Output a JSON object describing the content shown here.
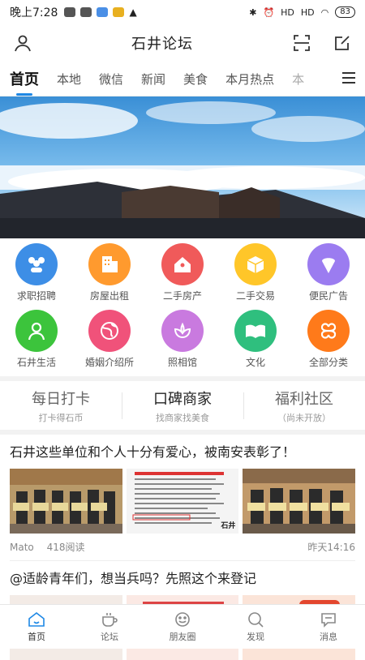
{
  "status": {
    "time": "晚上7:28",
    "battery": "83",
    "signal1": "HD",
    "signal2": "HD"
  },
  "header": {
    "title": "石井论坛"
  },
  "tabs": [
    "首页",
    "本地",
    "微信",
    "新闻",
    "美食",
    "本月热点",
    "本"
  ],
  "categories": [
    {
      "label": "求职招聘",
      "color": "#3d8ee6",
      "icon": "people-icon"
    },
    {
      "label": "房屋出租",
      "color": "#ff9a2e",
      "icon": "building-icon"
    },
    {
      "label": "二手房产",
      "color": "#f05a5a",
      "icon": "house-icon"
    },
    {
      "label": "二手交易",
      "color": "#ffc629",
      "icon": "box-icon"
    },
    {
      "label": "便民广告",
      "color": "#9b7cf0",
      "icon": "icecream-icon"
    },
    {
      "label": "石井生活",
      "color": "#3cc43c",
      "icon": "person-icon"
    },
    {
      "label": "婚姻介绍所",
      "color": "#f0527a",
      "icon": "globe-icon"
    },
    {
      "label": "照相馆",
      "color": "#c97adf",
      "icon": "flower-icon"
    },
    {
      "label": "文化",
      "color": "#2fbf7e",
      "icon": "book-icon"
    },
    {
      "label": "全部分类",
      "color": "#ff7a1a",
      "icon": "clover-icon"
    }
  ],
  "promos": [
    {
      "title": "每日打卡",
      "sub": "打卡得石币"
    },
    {
      "title": "口碑商家",
      "sub": "找商家找美食"
    },
    {
      "title": "福利社区",
      "sub": "（尚未开放）"
    }
  ],
  "articles": [
    {
      "title": "石井这些单位和个人十分有爱心，被南安表彰了！",
      "author": "Mato",
      "reads": "418阅读",
      "time": "昨天14:16",
      "thumb_brand": "石井"
    },
    {
      "title": "@适龄青年们，想当兵吗？先照这个来登记",
      "author": "",
      "reads": "",
      "time": ""
    }
  ],
  "nav": [
    {
      "label": "首页",
      "icon": "home-icon"
    },
    {
      "label": "论坛",
      "icon": "cup-icon"
    },
    {
      "label": "朋友圈",
      "icon": "smile-icon"
    },
    {
      "label": "发现",
      "icon": "search-icon"
    },
    {
      "label": "消息",
      "icon": "chat-icon"
    }
  ]
}
